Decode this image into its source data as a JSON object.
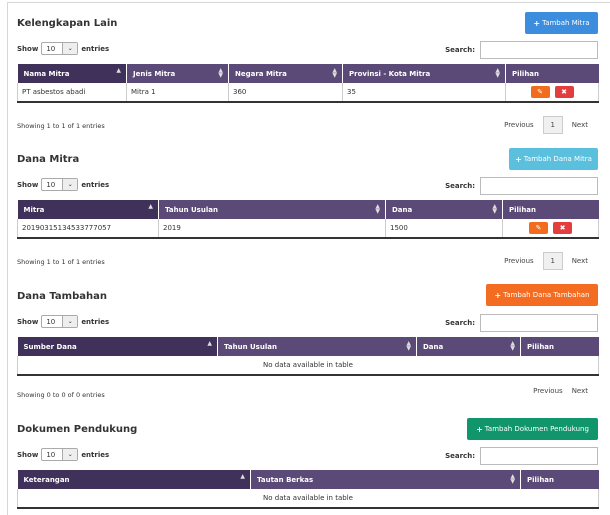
{
  "common": {
    "show_label": "Show",
    "entries_label": "entries",
    "length_value": "10",
    "search_label": "Search:",
    "previous": "Previous",
    "next": "Next",
    "page": "1"
  },
  "sections": [
    {
      "title": "Kelengkapan Lain",
      "add_button": "Tambah Mitra",
      "button_color": "#3c8dde",
      "columns": [
        "Nama Mitra",
        "Jenis Mitra",
        "Negara Mitra",
        "Provinsi - Kota Mitra",
        "Pilihan"
      ],
      "rows": [
        [
          "PT asbestos abadi",
          "Mitra 1",
          "360",
          "35"
        ]
      ],
      "empty_text": "",
      "info": "Showing 1 to 1 of 1 entries"
    },
    {
      "title": "Dana Mitra",
      "add_button": "Tambah Dana Mitra",
      "button_color": "#5bc0de",
      "columns": [
        "Mitra",
        "Tahun Usulan",
        "Dana",
        "Pilihan"
      ],
      "rows": [
        [
          "20190315134533777057",
          "2019",
          "1500"
        ]
      ],
      "empty_text": "",
      "info": "Showing 1 to 1 of 1 entries"
    },
    {
      "title": "Dana Tambahan",
      "add_button": "Tambah Dana Tambahan",
      "button_color": "#f36c21",
      "columns": [
        "Sumber Dana",
        "Tahun Usulan",
        "Dana",
        "Pilihan"
      ],
      "rows": [],
      "empty_text": "No data available in table",
      "info": "Showing 0 to 0 of 0 entries"
    },
    {
      "title": "Dokumen Pendukung",
      "add_button": "Tambah Dokumen Pendukung",
      "button_color": "#11966c",
      "columns": [
        "Keterangan",
        "Tautan Berkas",
        "Pilihan"
      ],
      "rows": [],
      "empty_text": "No data available in table",
      "info": ""
    }
  ]
}
